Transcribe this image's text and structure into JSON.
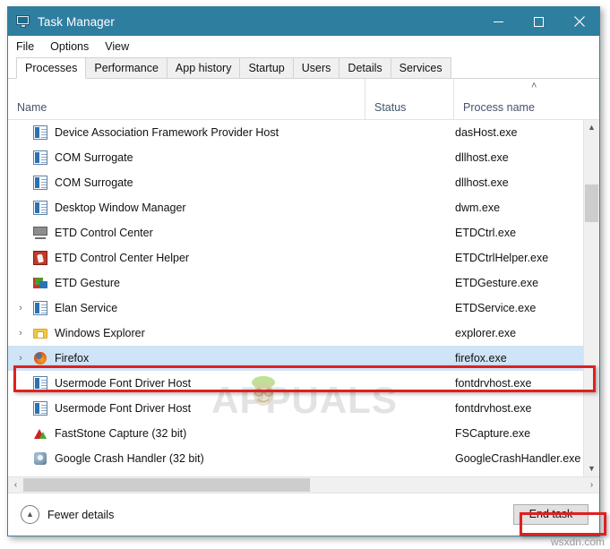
{
  "window": {
    "title": "Task Manager",
    "icon": "task-manager-icon",
    "controls": {
      "minimize": "minimize-icon",
      "maximize": "maximize-icon",
      "close": "close-icon"
    },
    "titlebar_color": "#2e7ea0"
  },
  "menubar": {
    "items": [
      {
        "label": "File"
      },
      {
        "label": "Options"
      },
      {
        "label": "View"
      }
    ]
  },
  "tabs": [
    {
      "label": "Processes",
      "active": true
    },
    {
      "label": "Performance",
      "active": false
    },
    {
      "label": "App history",
      "active": false
    },
    {
      "label": "Startup",
      "active": false
    },
    {
      "label": "Users",
      "active": false
    },
    {
      "label": "Details",
      "active": false
    },
    {
      "label": "Services",
      "active": false
    }
  ],
  "columns": {
    "name": "Name",
    "status": "Status",
    "process_name": "Process name",
    "sort_indicator": "˄",
    "sorted_by": "Process name",
    "sort_direction": "ascending"
  },
  "rows": [
    {
      "name": "Device Association Framework Provider Host",
      "status": "",
      "process": "dasHost.exe",
      "icon": "generic-process-icon",
      "expandable": false,
      "selected": false
    },
    {
      "name": "COM Surrogate",
      "status": "",
      "process": "dllhost.exe",
      "icon": "generic-process-icon",
      "expandable": false,
      "selected": false
    },
    {
      "name": "COM Surrogate",
      "status": "",
      "process": "dllhost.exe",
      "icon": "generic-process-icon",
      "expandable": false,
      "selected": false
    },
    {
      "name": "Desktop Window Manager",
      "status": "",
      "process": "dwm.exe",
      "icon": "generic-process-icon",
      "expandable": false,
      "selected": false
    },
    {
      "name": "ETD Control Center",
      "status": "",
      "process": "ETDCtrl.exe",
      "icon": "monitor-icon",
      "expandable": false,
      "selected": false
    },
    {
      "name": "ETD Control Center Helper",
      "status": "",
      "process": "ETDCtrlHelper.exe",
      "icon": "hand-pointer-icon",
      "expandable": false,
      "selected": false
    },
    {
      "name": "ETD Gesture",
      "status": "",
      "process": "ETDGesture.exe",
      "icon": "gesture-icon",
      "expandable": false,
      "selected": false
    },
    {
      "name": "Elan Service",
      "status": "",
      "process": "ETDService.exe",
      "icon": "generic-process-icon",
      "expandable": true,
      "selected": false
    },
    {
      "name": "Windows Explorer",
      "status": "",
      "process": "explorer.exe",
      "icon": "folder-icon",
      "expandable": true,
      "selected": false
    },
    {
      "name": "Firefox",
      "status": "",
      "process": "firefox.exe",
      "icon": "firefox-icon",
      "expandable": true,
      "selected": true
    },
    {
      "name": "Usermode Font Driver Host",
      "status": "",
      "process": "fontdrvhost.exe",
      "icon": "generic-process-icon",
      "expandable": false,
      "selected": false
    },
    {
      "name": "Usermode Font Driver Host",
      "status": "",
      "process": "fontdrvhost.exe",
      "icon": "generic-process-icon",
      "expandable": false,
      "selected": false
    },
    {
      "name": "FastStone Capture (32 bit)",
      "status": "",
      "process": "FSCapture.exe",
      "icon": "faststone-icon",
      "expandable": false,
      "selected": false
    },
    {
      "name": "Google Crash Handler (32 bit)",
      "status": "",
      "process": "GoogleCrashHandler.exe",
      "icon": "google-crash-handler-icon",
      "expandable": false,
      "selected": false
    }
  ],
  "scrollbars": {
    "vertical": {
      "up": "chevron-up-icon",
      "down": "chevron-down-icon"
    },
    "horizontal": {
      "left": "chevron-left-icon",
      "right": "chevron-right-icon"
    }
  },
  "footer": {
    "fewer_details_label": "Fewer details",
    "fewer_details_icon": "chevron-up-circle-icon",
    "end_task_label": "End task"
  },
  "annotations": {
    "color": "#e02020",
    "boxes": [
      {
        "target": "Firefox row"
      },
      {
        "target": "End task button"
      }
    ]
  },
  "watermarks": {
    "center": "APPUALS",
    "corner": "wsxdn.com"
  }
}
